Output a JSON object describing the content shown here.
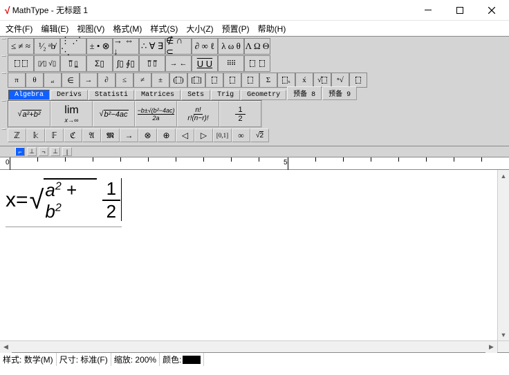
{
  "window": {
    "app_name": "MathType",
    "title_sep": " - ",
    "doc_title": "无标题 1"
  },
  "menu": {
    "file": "文件(F)",
    "edit": "编辑(E)",
    "view": "视图(V)",
    "format": "格式(M)",
    "style": "样式(S)",
    "size": "大小(Z)",
    "prefs": "预置(P)",
    "help": "帮助(H)"
  },
  "symbol_row1": [
    "≤ ≠ ≈",
    "¹⁄₂ ᵃb̸",
    "⋮ ⋰ ⋱",
    "± • ⊗",
    "→ ⇔ ↓",
    "∴ ∀ ∃",
    "∉ ∩ ⊂",
    "∂ ∞ ℓ",
    "λ ω θ",
    "Λ Ω Θ"
  ],
  "template_row1": [
    "(▯) [▯]",
    "▯⁄▯ √▯",
    "▯̅ ▯̲",
    "Σ▯ Σ▯",
    "∫▯ ∮▯",
    "▯̅ ▯̅",
    "→ ←",
    "▯́ ▯̂",
    "▯▯▯",
    "▯  ▯"
  ],
  "template_row2": [
    "π",
    "θ",
    "ₐᵢ",
    "∈",
    "→",
    "∂",
    "≤",
    "≠",
    "±",
    "()",
    "[]",
    "▯",
    "▯",
    "▯",
    "Σ",
    "ₓ",
    "x́",
    "√▯",
    "ⁿ⁄",
    "▯"
  ],
  "tabs": {
    "items": [
      "Algebra",
      "Derivs",
      "Statisti",
      "Matrices",
      "Sets",
      "Trig",
      "Geometry",
      "预备 8",
      "预备 9"
    ],
    "active": 0
  },
  "expr_row": [
    "√(a²+b²)",
    "lim x→∞",
    "√(b²−4ac)",
    "(−b±√(b²−4ac))/2a",
    "n! / r!(n−r)!",
    "1/2"
  ],
  "mini_row": [
    "ℤ",
    "𝕜",
    "𝔽",
    "ℭ",
    "𝔄",
    "𝕸",
    "→",
    "⊗",
    "⊕",
    "◁",
    "▷",
    "[0,1]",
    "∞",
    "√2"
  ],
  "ruler": {
    "zero": "0",
    "five": "5"
  },
  "equation": {
    "lhs": "x=",
    "rad_a": "a",
    "rad_plus": " + ",
    "rad_b": "b",
    "exp": "2",
    "frac_num": "1",
    "frac_den": "2"
  },
  "status": {
    "style_label": "样式:",
    "style_value": "数学(M)",
    "size_label": "尺寸:",
    "size_value": "标准(F)",
    "zoom_label": "缩放:",
    "zoom_value": "200%",
    "color_label": "颜色:"
  }
}
